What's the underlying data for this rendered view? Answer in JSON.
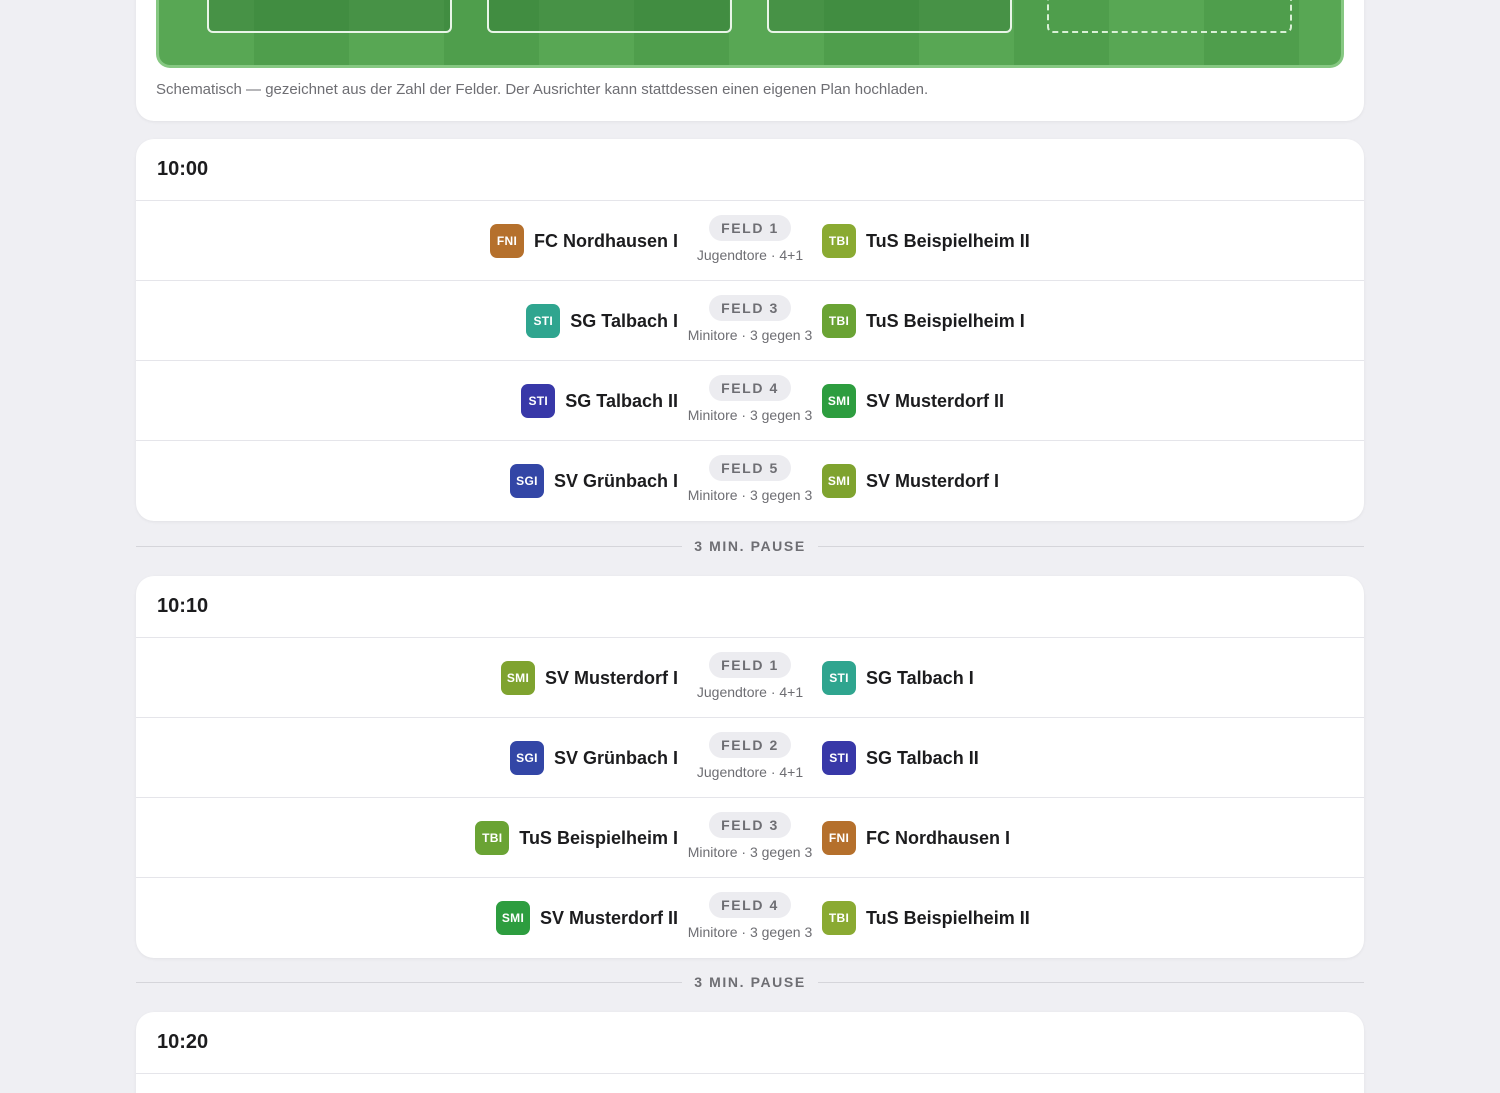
{
  "plan": {
    "caption": "Schematisch — gezeichnet aus der Zahl der Felder. Der Ausrichter kann stattdessen einen eigenen Plan hochladen."
  },
  "colors": {
    "FNI": "#b5702c",
    "TBI_a": "#8aaa32",
    "TBI_b": "#6aa334",
    "STI_a": "#2fa58f",
    "STI_b": "#3838a8",
    "SMI_a": "#2d9d3f",
    "SMI_b": "#7fa32f",
    "SGI": "#3346a6"
  },
  "rounds": [
    {
      "time": "10:00",
      "matches": [
        {
          "home": {
            "abbr": "FNI",
            "name": "FC Nordhausen I",
            "color": "#b5702c"
          },
          "field": "FELD 1",
          "sub": "Jugendtore · 4+1",
          "away": {
            "abbr": "TBI",
            "name": "TuS Beispielheim II",
            "color": "#8aaa32"
          }
        },
        {
          "home": {
            "abbr": "STI",
            "name": "SG Talbach I",
            "color": "#2fa58f"
          },
          "field": "FELD 3",
          "sub": "Minitore · 3 gegen 3",
          "away": {
            "abbr": "TBI",
            "name": "TuS Beispielheim I",
            "color": "#6aa334"
          }
        },
        {
          "home": {
            "abbr": "STI",
            "name": "SG Talbach II",
            "color": "#3838a8"
          },
          "field": "FELD 4",
          "sub": "Minitore · 3 gegen 3",
          "away": {
            "abbr": "SMI",
            "name": "SV Musterdorf II",
            "color": "#2d9d3f"
          }
        },
        {
          "home": {
            "abbr": "SGI",
            "name": "SV Grünbach I",
            "color": "#3346a6"
          },
          "field": "FELD 5",
          "sub": "Minitore · 3 gegen 3",
          "away": {
            "abbr": "SMI",
            "name": "SV Musterdorf I",
            "color": "#7fa32f"
          }
        }
      ]
    },
    {
      "time": "10:10",
      "matches": [
        {
          "home": {
            "abbr": "SMI",
            "name": "SV Musterdorf I",
            "color": "#7fa32f"
          },
          "field": "FELD 1",
          "sub": "Jugendtore · 4+1",
          "away": {
            "abbr": "STI",
            "name": "SG Talbach I",
            "color": "#2fa58f"
          }
        },
        {
          "home": {
            "abbr": "SGI",
            "name": "SV Grünbach I",
            "color": "#3346a6"
          },
          "field": "FELD 2",
          "sub": "Jugendtore · 4+1",
          "away": {
            "abbr": "STI",
            "name": "SG Talbach II",
            "color": "#3838a8"
          }
        },
        {
          "home": {
            "abbr": "TBI",
            "name": "TuS Beispielheim I",
            "color": "#6aa334"
          },
          "field": "FELD 3",
          "sub": "Minitore · 3 gegen 3",
          "away": {
            "abbr": "FNI",
            "name": "FC Nordhausen I",
            "color": "#b5702c"
          }
        },
        {
          "home": {
            "abbr": "SMI",
            "name": "SV Musterdorf II",
            "color": "#2d9d3f"
          },
          "field": "FELD 4",
          "sub": "Minitore · 3 gegen 3",
          "away": {
            "abbr": "TBI",
            "name": "TuS Beispielheim II",
            "color": "#8aaa32"
          }
        }
      ]
    },
    {
      "time": "10:20",
      "matches": []
    }
  ],
  "pauses": [
    "3 MIN. PAUSE",
    "3 MIN. PAUSE"
  ]
}
